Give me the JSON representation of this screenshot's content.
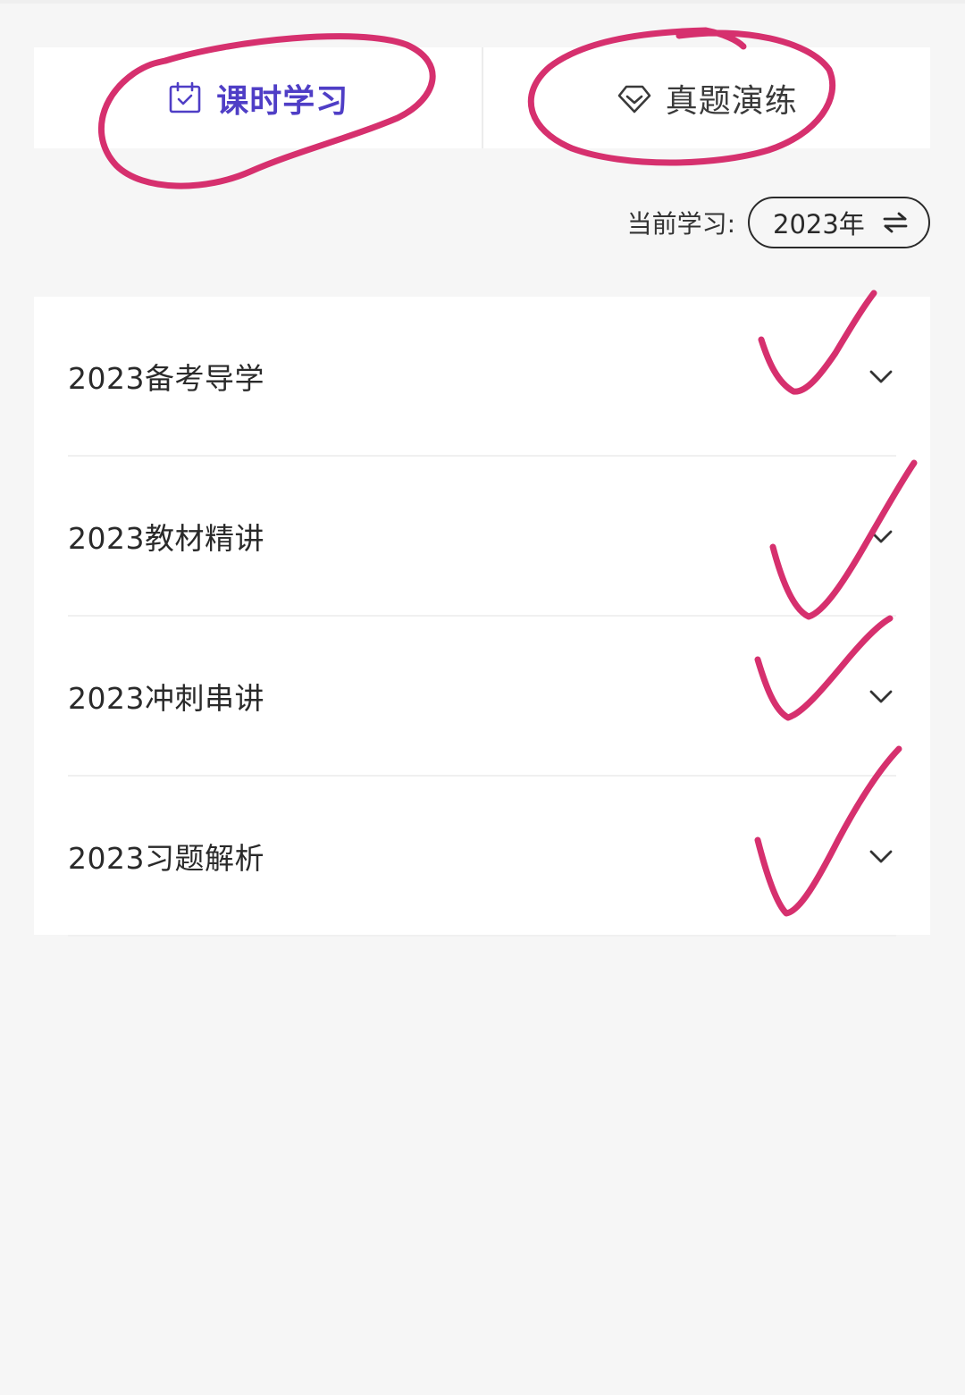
{
  "tabs": [
    {
      "label": "课时学习",
      "icon": "calendar-check-icon",
      "active": true
    },
    {
      "label": "真题演练",
      "icon": "diamond-icon",
      "active": false
    }
  ],
  "current_study": {
    "prefix": "当前学习:",
    "year": "2023年",
    "switch_icon": "swap-arrows-icon"
  },
  "courses": [
    {
      "title": "2023备考导学",
      "icon": "chevron-down-icon"
    },
    {
      "title": "2023教材精讲",
      "icon": "chevron-down-icon"
    },
    {
      "title": "2023冲刺串讲",
      "icon": "chevron-down-icon"
    },
    {
      "title": "2023习题解析",
      "icon": "chevron-down-icon"
    }
  ],
  "colors": {
    "accent": "#4f3ec6",
    "annotation": "#d6306e",
    "background": "#f6f6f6",
    "card": "#ffffff"
  }
}
